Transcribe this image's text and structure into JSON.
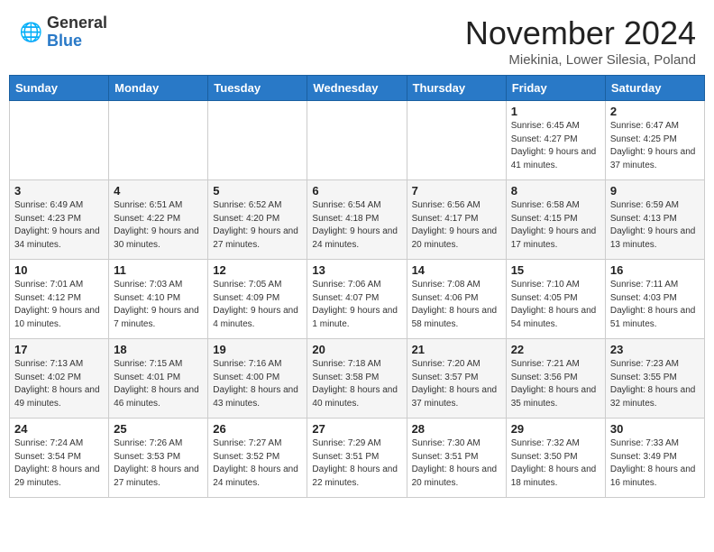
{
  "header": {
    "logo_general": "General",
    "logo_blue": "Blue",
    "title": "November 2024",
    "subtitle": "Miekinia, Lower Silesia, Poland"
  },
  "weekdays": [
    "Sunday",
    "Monday",
    "Tuesday",
    "Wednesday",
    "Thursday",
    "Friday",
    "Saturday"
  ],
  "weeks": [
    [
      {
        "day": "",
        "info": ""
      },
      {
        "day": "",
        "info": ""
      },
      {
        "day": "",
        "info": ""
      },
      {
        "day": "",
        "info": ""
      },
      {
        "day": "",
        "info": ""
      },
      {
        "day": "1",
        "info": "Sunrise: 6:45 AM\nSunset: 4:27 PM\nDaylight: 9 hours and 41 minutes."
      },
      {
        "day": "2",
        "info": "Sunrise: 6:47 AM\nSunset: 4:25 PM\nDaylight: 9 hours and 37 minutes."
      }
    ],
    [
      {
        "day": "3",
        "info": "Sunrise: 6:49 AM\nSunset: 4:23 PM\nDaylight: 9 hours and 34 minutes."
      },
      {
        "day": "4",
        "info": "Sunrise: 6:51 AM\nSunset: 4:22 PM\nDaylight: 9 hours and 30 minutes."
      },
      {
        "day": "5",
        "info": "Sunrise: 6:52 AM\nSunset: 4:20 PM\nDaylight: 9 hours and 27 minutes."
      },
      {
        "day": "6",
        "info": "Sunrise: 6:54 AM\nSunset: 4:18 PM\nDaylight: 9 hours and 24 minutes."
      },
      {
        "day": "7",
        "info": "Sunrise: 6:56 AM\nSunset: 4:17 PM\nDaylight: 9 hours and 20 minutes."
      },
      {
        "day": "8",
        "info": "Sunrise: 6:58 AM\nSunset: 4:15 PM\nDaylight: 9 hours and 17 minutes."
      },
      {
        "day": "9",
        "info": "Sunrise: 6:59 AM\nSunset: 4:13 PM\nDaylight: 9 hours and 13 minutes."
      }
    ],
    [
      {
        "day": "10",
        "info": "Sunrise: 7:01 AM\nSunset: 4:12 PM\nDaylight: 9 hours and 10 minutes."
      },
      {
        "day": "11",
        "info": "Sunrise: 7:03 AM\nSunset: 4:10 PM\nDaylight: 9 hours and 7 minutes."
      },
      {
        "day": "12",
        "info": "Sunrise: 7:05 AM\nSunset: 4:09 PM\nDaylight: 9 hours and 4 minutes."
      },
      {
        "day": "13",
        "info": "Sunrise: 7:06 AM\nSunset: 4:07 PM\nDaylight: 9 hours and 1 minute."
      },
      {
        "day": "14",
        "info": "Sunrise: 7:08 AM\nSunset: 4:06 PM\nDaylight: 8 hours and 58 minutes."
      },
      {
        "day": "15",
        "info": "Sunrise: 7:10 AM\nSunset: 4:05 PM\nDaylight: 8 hours and 54 minutes."
      },
      {
        "day": "16",
        "info": "Sunrise: 7:11 AM\nSunset: 4:03 PM\nDaylight: 8 hours and 51 minutes."
      }
    ],
    [
      {
        "day": "17",
        "info": "Sunrise: 7:13 AM\nSunset: 4:02 PM\nDaylight: 8 hours and 49 minutes."
      },
      {
        "day": "18",
        "info": "Sunrise: 7:15 AM\nSunset: 4:01 PM\nDaylight: 8 hours and 46 minutes."
      },
      {
        "day": "19",
        "info": "Sunrise: 7:16 AM\nSunset: 4:00 PM\nDaylight: 8 hours and 43 minutes."
      },
      {
        "day": "20",
        "info": "Sunrise: 7:18 AM\nSunset: 3:58 PM\nDaylight: 8 hours and 40 minutes."
      },
      {
        "day": "21",
        "info": "Sunrise: 7:20 AM\nSunset: 3:57 PM\nDaylight: 8 hours and 37 minutes."
      },
      {
        "day": "22",
        "info": "Sunrise: 7:21 AM\nSunset: 3:56 PM\nDaylight: 8 hours and 35 minutes."
      },
      {
        "day": "23",
        "info": "Sunrise: 7:23 AM\nSunset: 3:55 PM\nDaylight: 8 hours and 32 minutes."
      }
    ],
    [
      {
        "day": "24",
        "info": "Sunrise: 7:24 AM\nSunset: 3:54 PM\nDaylight: 8 hours and 29 minutes."
      },
      {
        "day": "25",
        "info": "Sunrise: 7:26 AM\nSunset: 3:53 PM\nDaylight: 8 hours and 27 minutes."
      },
      {
        "day": "26",
        "info": "Sunrise: 7:27 AM\nSunset: 3:52 PM\nDaylight: 8 hours and 24 minutes."
      },
      {
        "day": "27",
        "info": "Sunrise: 7:29 AM\nSunset: 3:51 PM\nDaylight: 8 hours and 22 minutes."
      },
      {
        "day": "28",
        "info": "Sunrise: 7:30 AM\nSunset: 3:51 PM\nDaylight: 8 hours and 20 minutes."
      },
      {
        "day": "29",
        "info": "Sunrise: 7:32 AM\nSunset: 3:50 PM\nDaylight: 8 hours and 18 minutes."
      },
      {
        "day": "30",
        "info": "Sunrise: 7:33 AM\nSunset: 3:49 PM\nDaylight: 8 hours and 16 minutes."
      }
    ]
  ]
}
